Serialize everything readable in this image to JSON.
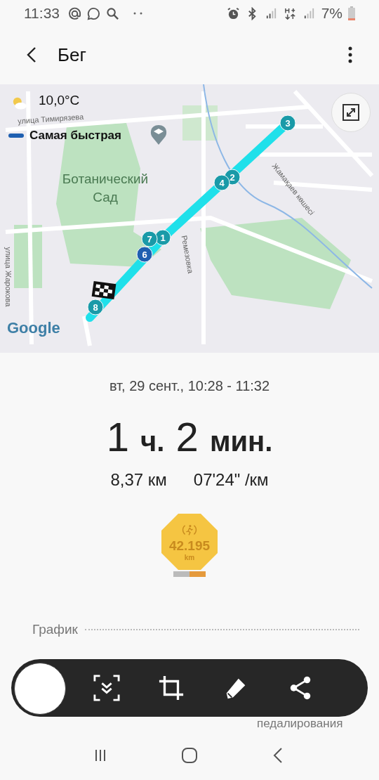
{
  "status_bar": {
    "time": "11:33",
    "battery": "7%"
  },
  "header": {
    "title": "Бег"
  },
  "map": {
    "temperature": "10,0°C",
    "legend": "Самая быстрая",
    "park": "Ботанический Сад",
    "streets": [
      "улица Тимирязева",
      "Жамақаев көшесі",
      "улица Жарокова",
      "Ремезовка"
    ],
    "logo": "Google",
    "markers": [
      {
        "label": "3",
        "color": "#1a9aa8"
      },
      {
        "label": "2",
        "color": "#1a9aa8"
      },
      {
        "label": "4",
        "color": "#1a9aa8"
      },
      {
        "label": "1",
        "color": "#1a9aa8"
      },
      {
        "label": "7",
        "color": "#1a9aa8"
      },
      {
        "label": "6",
        "color": "#1f5fb0"
      },
      {
        "label": "8",
        "color": "#1a9aa8"
      }
    ]
  },
  "workout": {
    "date": "вт, 29 сент., 10:28 - 11:32",
    "duration": "1 **ч.** 2 **мин.**",
    "distance": "8,37 км",
    "pace": "07'24\" /км"
  },
  "medal": {
    "value": "42.195",
    "unit": "km"
  },
  "graph": {
    "title": "График",
    "visible_label": "педалирования"
  }
}
